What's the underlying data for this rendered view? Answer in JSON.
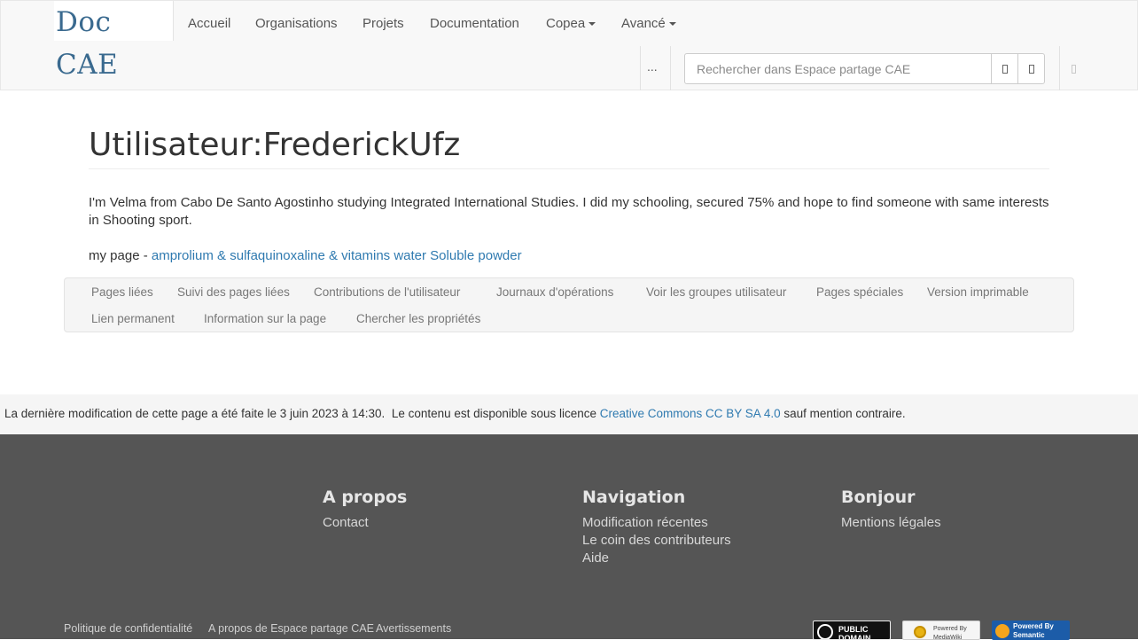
{
  "navbar": {
    "brand": "Doc CAE",
    "items": [
      {
        "label": "Accueil"
      },
      {
        "label": "Organisations"
      },
      {
        "label": "Projets"
      },
      {
        "label": "Documentation"
      },
      {
        "label": "Copea",
        "dropdown": true
      },
      {
        "label": "Avancé",
        "dropdown": true
      }
    ],
    "more_label": "...",
    "search_placeholder": "Rechercher dans Espace partage CAE",
    "search_value": "",
    "icons": [
      "go-icon",
      "search-icon",
      "user-icon"
    ]
  },
  "page": {
    "title": "Utilisateur:FrederickUfz",
    "bio": "I'm Velma from Cabo De Santo Agostinho studying Integrated International Studies. I did my schooling, secured 75% and hope to find someone with same interests in Shooting sport.",
    "mypage_prefix": "my page -",
    "mypage_link": "amprolium & sulfaquinoxaline & vitamins water Soluble powder"
  },
  "toolbox": {
    "items": [
      "Pages liées",
      "Suivi des pages liées",
      "Contributions de l'utilisateur",
      "Journaux d'opérations",
      "Voir les groupes utilisateur",
      "Pages spéciales",
      "Version imprimable",
      "Lien permanent",
      "Information sur la page",
      "Chercher les propriétés"
    ]
  },
  "lastmod": {
    "text": "La dernière modification de cette page a été faite le 3 juin 2023 à 14:30.",
    "license_prefix": "Le contenu est disponible sous licence",
    "license_link": "Creative Commons CC BY SA 4.0",
    "license_suffix": "sauf mention contraire."
  },
  "footer": {
    "columns": [
      {
        "title": "A propos",
        "links": [
          "Contact"
        ]
      },
      {
        "title": "Navigation",
        "links": [
          "Modification récentes",
          "Le coin des contributeurs",
          "Aide"
        ]
      },
      {
        "title": "Bonjour",
        "links": [
          "Mentions légales"
        ]
      }
    ],
    "bottom_links": [
      "Politique de confidentialité",
      "A propos de Espace partage CAE",
      "Avertissements"
    ],
    "badges": {
      "public_domain": "PUBLIC DOMAIN",
      "mediawiki": "Powered By MediaWiki",
      "smw": "Powered By Semantic"
    },
    "colors": {
      "background": "#555555",
      "link": "#2f7ab0"
    }
  }
}
